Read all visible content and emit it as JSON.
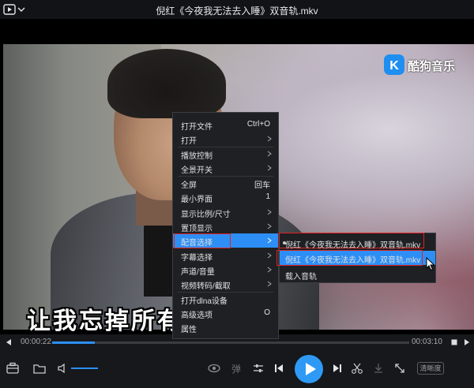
{
  "window": {
    "title": "倪红《今夜我无法去入睡》双音轨.mkv"
  },
  "video": {
    "watermark_text": "酷狗音乐",
    "subtitle": "让我忘掉所有"
  },
  "progress": {
    "current_time": "00:00:22",
    "total_time": "00:03:10",
    "played_fraction": 0.12
  },
  "controls": {
    "quality_label": "清晰度",
    "volume_fraction": 1.0
  },
  "context_menu": {
    "items": [
      {
        "label": "打开文件",
        "shortcut": "Ctrl+O"
      },
      {
        "label": "打开",
        "shortcut": ""
      },
      {
        "label": "播放控制",
        "shortcut": ""
      },
      {
        "label": "全景开关",
        "shortcut": ""
      },
      {
        "label": "全屏",
        "shortcut": "回车"
      },
      {
        "label": "最小界面",
        "shortcut": "1"
      },
      {
        "label": "显示比例/尺寸",
        "shortcut": ""
      },
      {
        "label": "置顶显示",
        "shortcut": ""
      },
      {
        "label": "配音选择",
        "shortcut": ""
      },
      {
        "label": "字幕选择",
        "shortcut": ""
      },
      {
        "label": "声道/音量",
        "shortcut": ""
      },
      {
        "label": "视频转码/截取",
        "shortcut": ""
      },
      {
        "label": "打开dlna设备",
        "shortcut": ""
      },
      {
        "label": "高级选项",
        "shortcut": "O"
      },
      {
        "label": "属性",
        "shortcut": ""
      }
    ]
  },
  "audio_submenu": {
    "items": [
      {
        "label": "倪红《今夜我无法去入睡》双音轨.mkv"
      },
      {
        "label": "倪红《今夜我无法去入睡》双音轨.mkv"
      },
      {
        "label": "载入音轨"
      }
    ]
  },
  "colors": {
    "accent": "#2d8ff5",
    "highlight_box": "#e02020"
  }
}
